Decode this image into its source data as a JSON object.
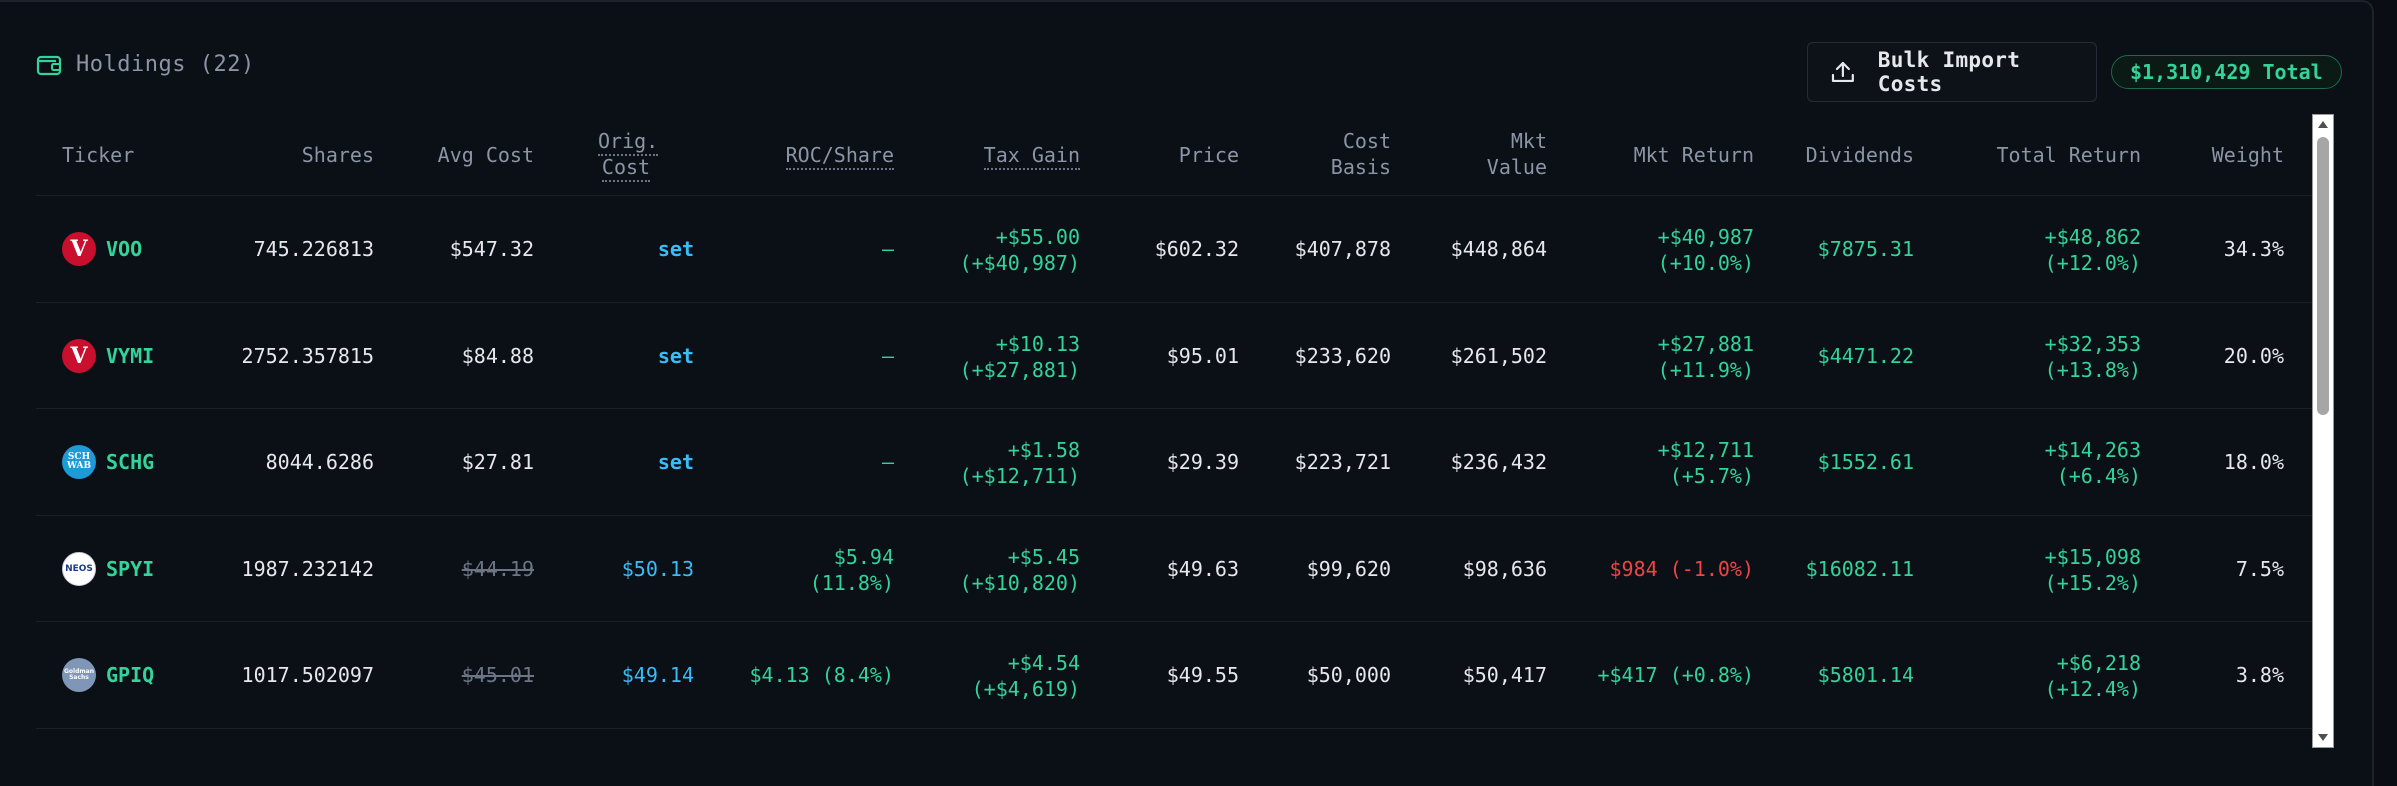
{
  "header": {
    "title": "Holdings (22)",
    "bulk_import_label": "Bulk Import Costs",
    "total_label": "$1,310,429 Total"
  },
  "columns": {
    "ticker": "Ticker",
    "shares": "Shares",
    "avg_cost": "Avg Cost",
    "orig_cost_1": "Orig.",
    "orig_cost_2": "Cost",
    "roc_share": "ROC/Share",
    "tax_gain": "Tax Gain",
    "price": "Price",
    "cost_basis_1": "Cost",
    "cost_basis_2": "Basis",
    "mkt_value_1": "Mkt",
    "mkt_value_2": "Value",
    "mkt_return": "Mkt Return",
    "dividends": "Dividends",
    "total_return": "Total Return",
    "weight": "Weight"
  },
  "rows": [
    {
      "logo": "vanguard-logo",
      "logo_text": "V",
      "ticker": "VOO",
      "shares": "745.226813",
      "avg_cost": "$547.32",
      "avg_cost_struck": false,
      "orig_cost": "set",
      "roc": "—",
      "roc_pct": "",
      "tax_gain_1": "+$55.00",
      "tax_gain_2": "(+$40,987)",
      "price": "$602.32",
      "cost_basis": "$407,878",
      "mkt_value": "$448,864",
      "mkt_return_1": "+$40,987",
      "mkt_return_2": "(+10.0%)",
      "mkt_return_color": "green",
      "dividends": "$7875.31",
      "total_return_1": "+$48,862",
      "total_return_2": "(+12.0%)",
      "weight": "34.3%"
    },
    {
      "logo": "vanguard-logo",
      "logo_text": "V",
      "ticker": "VYMI",
      "shares": "2752.357815",
      "avg_cost": "$84.88",
      "avg_cost_struck": false,
      "orig_cost": "set",
      "roc": "—",
      "roc_pct": "",
      "tax_gain_1": "+$10.13",
      "tax_gain_2": "(+$27,881)",
      "price": "$95.01",
      "cost_basis": "$233,620",
      "mkt_value": "$261,502",
      "mkt_return_1": "+$27,881",
      "mkt_return_2": "(+11.9%)",
      "mkt_return_color": "green",
      "dividends": "$4471.22",
      "total_return_1": "+$32,353",
      "total_return_2": "(+13.8%)",
      "weight": "20.0%"
    },
    {
      "logo": "schwab-logo",
      "logo_text": "SCH WAB",
      "ticker": "SCHG",
      "shares": "8044.6286",
      "avg_cost": "$27.81",
      "avg_cost_struck": false,
      "orig_cost": "set",
      "roc": "—",
      "roc_pct": "",
      "tax_gain_1": "+$1.58",
      "tax_gain_2": "(+$12,711)",
      "price": "$29.39",
      "cost_basis": "$223,721",
      "mkt_value": "$236,432",
      "mkt_return_1": "+$12,711",
      "mkt_return_2": "(+5.7%)",
      "mkt_return_color": "green",
      "dividends": "$1552.61",
      "total_return_1": "+$14,263",
      "total_return_2": "(+6.4%)",
      "weight": "18.0%"
    },
    {
      "logo": "neos-logo",
      "logo_text": "NEOS",
      "ticker": "SPYI",
      "shares": "1987.232142",
      "avg_cost": "$44.19",
      "avg_cost_struck": true,
      "orig_cost": "$50.13",
      "roc": "$5.94",
      "roc_pct": "(11.8%)",
      "tax_gain_1": "+$5.45",
      "tax_gain_2": "(+$10,820)",
      "price": "$49.63",
      "cost_basis": "$99,620",
      "mkt_value": "$98,636",
      "mkt_return_1": "$984 (-1.0%)",
      "mkt_return_2": "",
      "mkt_return_color": "red",
      "dividends": "$16082.11",
      "total_return_1": "+$15,098",
      "total_return_2": "(+15.2%)",
      "weight": "7.5%"
    },
    {
      "logo": "goldman-logo",
      "logo_text": "Goldman Sachs",
      "ticker": "GPIQ",
      "shares": "1017.502097",
      "avg_cost": "$45.01",
      "avg_cost_struck": true,
      "orig_cost": "$49.14",
      "roc": "$4.13 (8.4%)",
      "roc_pct": "",
      "tax_gain_1": "+$4.54",
      "tax_gain_2": "(+$4,619)",
      "price": "$49.55",
      "cost_basis": "$50,000",
      "mkt_value": "$50,417",
      "mkt_return_1": "+$417 (+0.8%)",
      "mkt_return_2": "",
      "mkt_return_color": "green",
      "dividends": "$5801.14",
      "total_return_1": "+$6,218",
      "total_return_2": "(+12.4%)",
      "weight": "3.8%"
    }
  ],
  "colors": {
    "accent_green": "#34d399",
    "accent_cyan": "#38bdf8",
    "negative_red": "#ef4444"
  }
}
